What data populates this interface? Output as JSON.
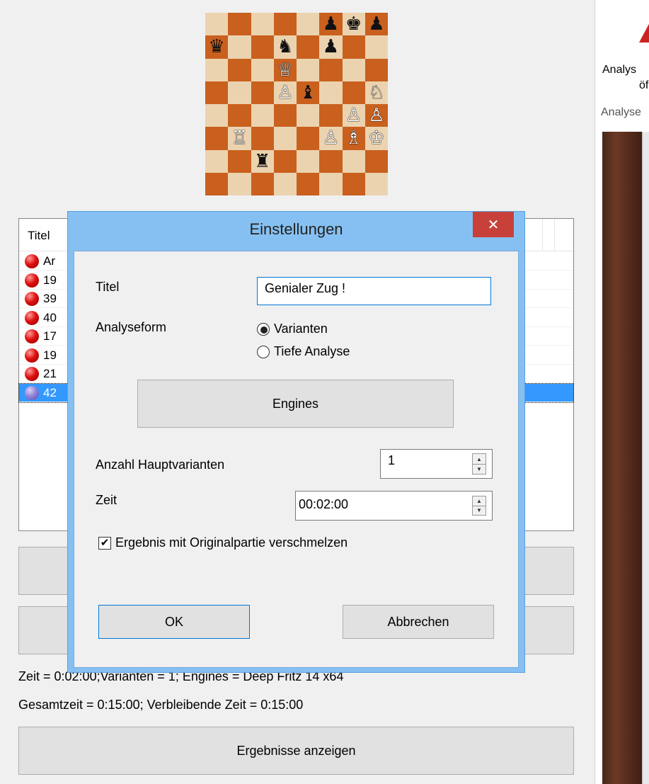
{
  "board": {
    "rows": [
      [
        {
          "p": "",
          "c": ""
        },
        {
          "p": "",
          "c": ""
        },
        {
          "p": "",
          "c": ""
        },
        {
          "p": "",
          "c": ""
        },
        {
          "p": "",
          "c": ""
        },
        {
          "p": "♟",
          "c": "b"
        },
        {
          "p": "♚",
          "c": "b"
        },
        {
          "p": "♟",
          "c": "b"
        }
      ],
      [
        {
          "p": "♛",
          "c": "b"
        },
        {
          "p": "",
          "c": ""
        },
        {
          "p": "",
          "c": ""
        },
        {
          "p": "♞",
          "c": "b"
        },
        {
          "p": "",
          "c": ""
        },
        {
          "p": "♟",
          "c": "b"
        },
        {
          "p": "",
          "c": ""
        },
        {
          "p": "",
          "c": ""
        }
      ],
      [
        {
          "p": "",
          "c": ""
        },
        {
          "p": "",
          "c": ""
        },
        {
          "p": "",
          "c": ""
        },
        {
          "p": "♕",
          "c": "w"
        },
        {
          "p": "",
          "c": ""
        },
        {
          "p": "",
          "c": ""
        },
        {
          "p": "",
          "c": ""
        },
        {
          "p": "",
          "c": ""
        }
      ],
      [
        {
          "p": "",
          "c": ""
        },
        {
          "p": "",
          "c": ""
        },
        {
          "p": "",
          "c": ""
        },
        {
          "p": "♙",
          "c": "w"
        },
        {
          "p": "♝",
          "c": "b"
        },
        {
          "p": "",
          "c": ""
        },
        {
          "p": "",
          "c": ""
        },
        {
          "p": "♘",
          "c": "w"
        }
      ],
      [
        {
          "p": "",
          "c": ""
        },
        {
          "p": "",
          "c": ""
        },
        {
          "p": "",
          "c": ""
        },
        {
          "p": "",
          "c": ""
        },
        {
          "p": "",
          "c": ""
        },
        {
          "p": "",
          "c": ""
        },
        {
          "p": "♙",
          "c": "w"
        },
        {
          "p": "♙",
          "c": "w"
        }
      ],
      [
        {
          "p": "",
          "c": ""
        },
        {
          "p": "♖",
          "c": "w"
        },
        {
          "p": "",
          "c": ""
        },
        {
          "p": "",
          "c": ""
        },
        {
          "p": "",
          "c": ""
        },
        {
          "p": "♙",
          "c": "w"
        },
        {
          "p": "♗",
          "c": "w"
        },
        {
          "p": "♔",
          "c": "w"
        }
      ],
      [
        {
          "p": "",
          "c": ""
        },
        {
          "p": "",
          "c": ""
        },
        {
          "p": "♜",
          "c": "b"
        },
        {
          "p": "",
          "c": ""
        },
        {
          "p": "",
          "c": ""
        },
        {
          "p": "",
          "c": ""
        },
        {
          "p": "",
          "c": ""
        },
        {
          "p": "",
          "c": ""
        }
      ],
      [
        {
          "p": "",
          "c": ""
        },
        {
          "p": "",
          "c": ""
        },
        {
          "p": "",
          "c": ""
        },
        {
          "p": "",
          "c": ""
        },
        {
          "p": "",
          "c": ""
        },
        {
          "p": "",
          "c": ""
        },
        {
          "p": "",
          "c": ""
        },
        {
          "p": "",
          "c": ""
        }
      ]
    ]
  },
  "list": {
    "header_title": "Titel",
    "rows": [
      "Ar",
      "19",
      "39",
      "40",
      "17",
      "19",
      "21",
      "42"
    ],
    "selected_index": 7
  },
  "status": {
    "line1": "Zeit = 0:02:00;Varianten = 1; Engines = Deep Fritz 14 x64",
    "line2": "Gesamtzeit = 0:15:00; Verbleibende Zeit = 0:15:00"
  },
  "buttons": {
    "show_results": "Ergebnisse anzeigen"
  },
  "ribbon": {
    "label_line1": "Analys",
    "label_line2": "öf",
    "group_label": "Analyse"
  },
  "dialog": {
    "title": "Einstellungen",
    "close_glyph": "✕",
    "titel_label": "Titel",
    "titel_value": "Genialer Zug !",
    "analyseform_label": "Analyseform",
    "radio_varianten": "Varianten",
    "radio_tiefe": "Tiefe Analyse",
    "selected_mode": "Varianten",
    "engines_button": "Engines",
    "hauptvarianten_label": "Anzahl Hauptvarianten",
    "hauptvarianten_value": "1",
    "zeit_label": "Zeit",
    "zeit_value": "00:02:00",
    "merge_label": "Ergebnis mit Originalpartie verschmelzen",
    "merge_checked": true,
    "ok_button": "OK",
    "cancel_button": "Abbrechen"
  }
}
